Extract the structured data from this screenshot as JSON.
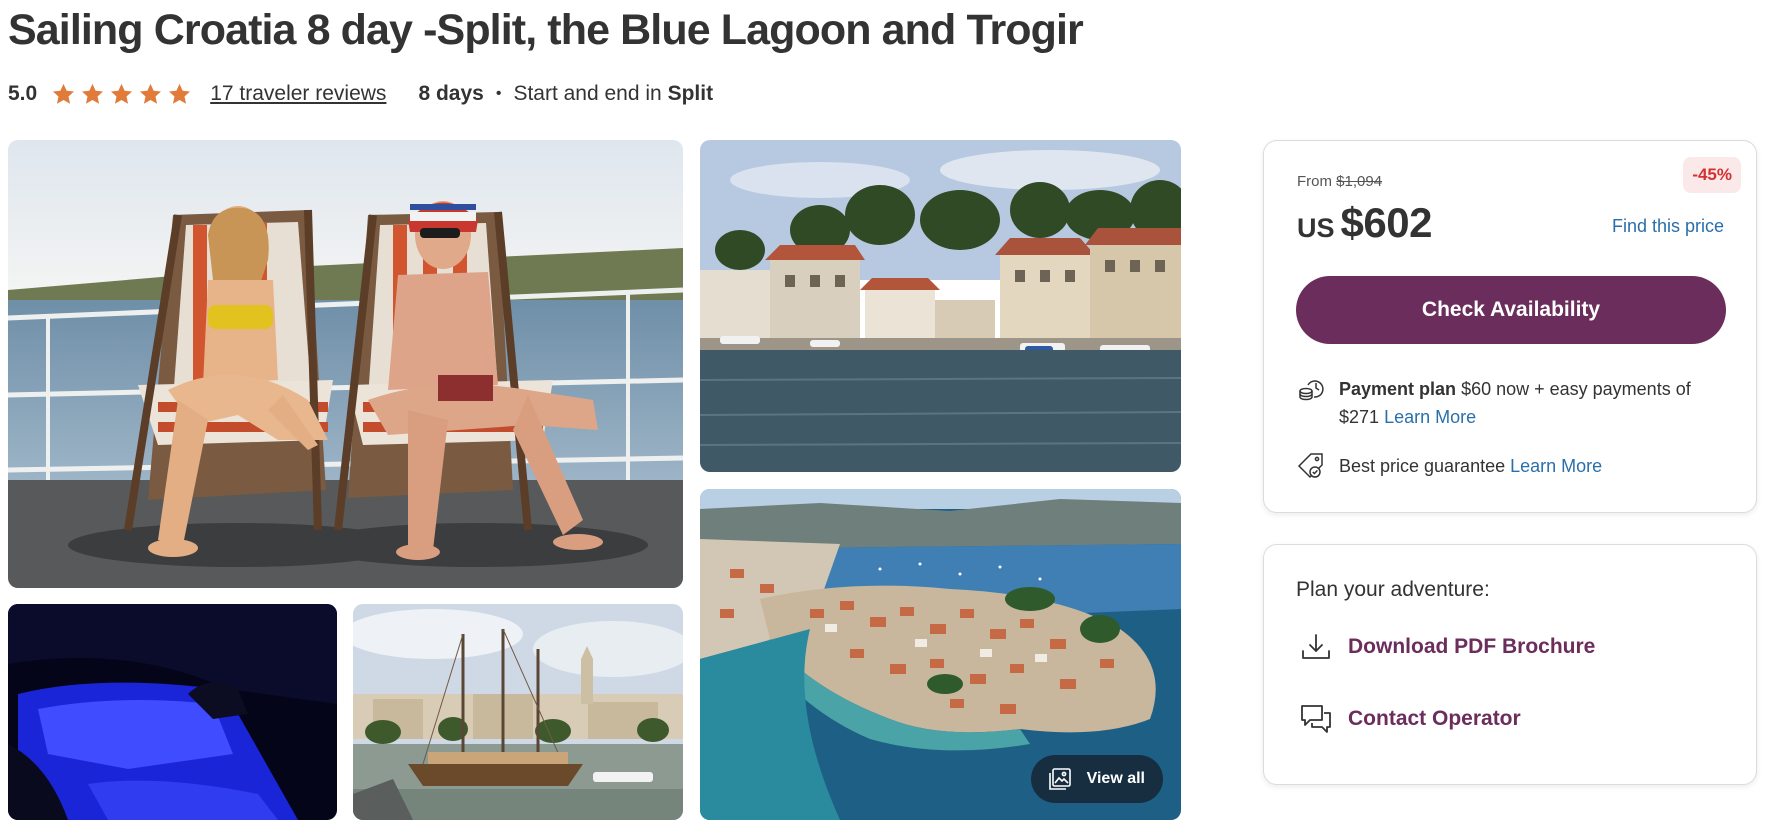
{
  "tour": {
    "title": "Sailing Croatia 8 day -Split, the Blue Lagoon and Trogir",
    "rating": "5.0",
    "stars": 5,
    "reviews_link": "17 traveler reviews",
    "duration": "8 days",
    "separator": "•",
    "start_end_prefix": "Start and end in",
    "start_end_city": "Split"
  },
  "gallery": {
    "view_all_label": "View all"
  },
  "pricing": {
    "from_label": "From",
    "original_price": "$1,094",
    "discount_badge": "-45%",
    "currency": "US",
    "price": "$602",
    "find_price_link": "Find this price",
    "cta_label": "Check Availability",
    "payment_plan_title": "Payment plan",
    "payment_plan_text": "$60 now + easy payments of $271",
    "payment_plan_link": "Learn More",
    "guarantee_text": "Best price guarantee",
    "guarantee_link": "Learn More"
  },
  "plan": {
    "title": "Plan your adventure:",
    "brochure_link": "Download PDF Brochure",
    "contact_link": "Contact Operator"
  },
  "colors": {
    "brand_purple": "#6b2d5c",
    "star_orange": "#e07b39",
    "link_blue": "#2a6fab",
    "discount_red": "#d43030"
  }
}
